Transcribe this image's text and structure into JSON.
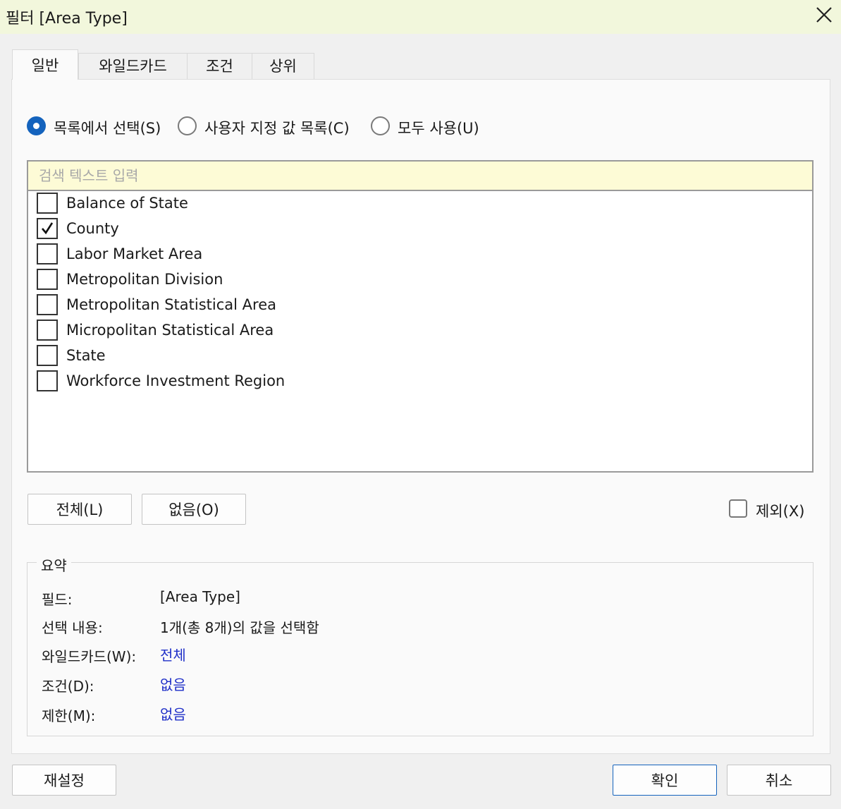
{
  "window": {
    "title": "필터 [Area Type]"
  },
  "tabs": [
    {
      "label": "일반",
      "active": true
    },
    {
      "label": "와일드카드",
      "active": false
    },
    {
      "label": "조건",
      "active": false
    },
    {
      "label": "상위",
      "active": false
    }
  ],
  "mode_options": [
    {
      "label": "목록에서 선택(S)",
      "selected": true
    },
    {
      "label": "사용자 지정 값 목록(C)",
      "selected": false
    },
    {
      "label": "모두 사용(U)",
      "selected": false
    }
  ],
  "search": {
    "placeholder": "검색 텍스트 입력",
    "value": ""
  },
  "values": [
    {
      "label": "Balance of State",
      "checked": false
    },
    {
      "label": "County",
      "checked": true
    },
    {
      "label": "Labor Market Area",
      "checked": false
    },
    {
      "label": "Metropolitan Division",
      "checked": false
    },
    {
      "label": "Metropolitan Statistical Area",
      "checked": false
    },
    {
      "label": "Micropolitan Statistical Area",
      "checked": false
    },
    {
      "label": "State",
      "checked": false
    },
    {
      "label": "Workforce Investment Region",
      "checked": false
    }
  ],
  "list_actions": {
    "all_label": "전체(L)",
    "none_label": "없음(O)"
  },
  "exclude": {
    "label": "제외(X)",
    "checked": false
  },
  "summary": {
    "title": "요약",
    "field_key": "필드:",
    "field_value": "[Area Type]",
    "selection_key": "선택 내용:",
    "selection_value": "1개(총 8개)의 값을 선택함",
    "wildcard_key": "와일드카드(W):",
    "wildcard_value": "전체",
    "condition_key": "조건(D):",
    "condition_value": "없음",
    "limit_key": "제한(M):",
    "limit_value": "없음"
  },
  "footer": {
    "reset_label": "재설정",
    "ok_label": "확인",
    "cancel_label": "취소"
  },
  "colors": {
    "title_bar": "#f2f7dc",
    "accent": "#1463bd",
    "search_bg": "#fdfbd6",
    "link": "#1f2fc8"
  },
  "icons": {
    "close": "close-icon",
    "check": "check-icon"
  }
}
